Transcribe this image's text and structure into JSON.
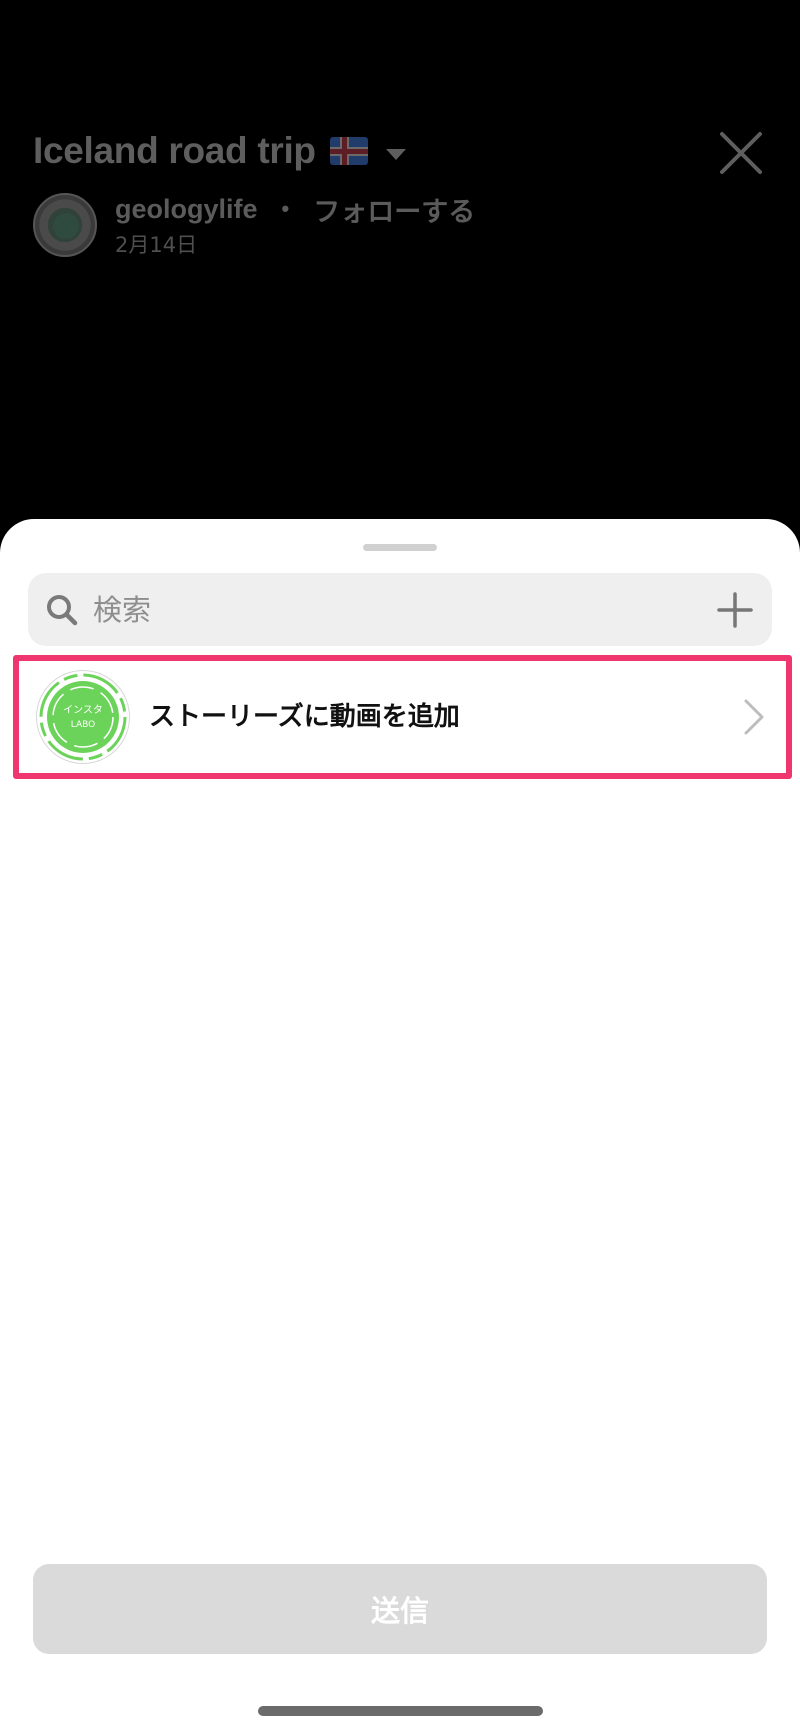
{
  "header": {
    "title": "Iceland road trip",
    "title_icon": "iceland-flag-emoji",
    "author": "geologylife",
    "separator": "•",
    "follow_label": "フォローする",
    "date": "2月14日"
  },
  "sheet": {
    "search": {
      "placeholder": "検索",
      "value": ""
    },
    "story_item": {
      "avatar_text_line1": "インスタ",
      "avatar_text_line2": "LABO",
      "label": "ストーリーズに動画を追加"
    },
    "send_label": "送信"
  },
  "colors": {
    "highlight_border": "#f0366f",
    "avatar_green": "#6cd35a",
    "send_button_disabled": "#dadada",
    "search_bg": "#efefef"
  }
}
